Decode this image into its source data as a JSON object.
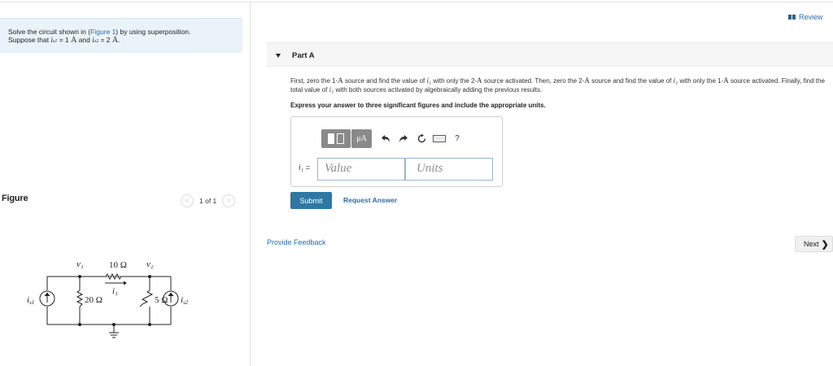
{
  "problem": {
    "line1_pre": "Solve the circuit shown in (",
    "figure_link": "Figure 1",
    "line1_post": ") by using superposition.",
    "line2_pre": "Suppose that ",
    "var_i_s1": "i",
    "sub_s1": "s1",
    "eq1": " = 1 ",
    "unit1": "A",
    "and": " and ",
    "var_i_s2": "i",
    "sub_s2": "s2",
    "eq2": " = 2 ",
    "unit2": "A",
    "end": "."
  },
  "figure": {
    "label": "Figure",
    "pager_text": "1 of 1",
    "prev_glyph": "‹",
    "next_glyph": "›"
  },
  "circuit": {
    "v1": "v₁",
    "v2": "v₂",
    "r_top": "10 Ω",
    "r_left": "20 Ω",
    "r_right": "5 Ω",
    "i1": "i₁",
    "is1": "i",
    "is1_sub": "s1",
    "is2": "i",
    "is2_sub": "s2"
  },
  "review": {
    "label": "Review"
  },
  "part": {
    "title": "Part A",
    "instructions": [
      "First, zero the 1-",
      "A",
      " source and find the value of ",
      "i₁",
      " with only the 2-",
      "A",
      " source activated. Then, zero the 2-",
      "A",
      " source and find the value of ",
      "i₁",
      " with only the 1-",
      "A",
      " source activated. Finally, find the total value of ",
      "i₁",
      " with both sources activated by algebraically adding the previous results."
    ],
    "express": "Express your answer to three significant figures and include the appropriate units."
  },
  "toolbar": {
    "units_label": "μA",
    "help": "?"
  },
  "answer": {
    "var_label": "i₁",
    "equals": " =",
    "value_placeholder": "Value",
    "units_placeholder": "Units"
  },
  "actions": {
    "submit": "Submit",
    "request_answer": "Request Answer",
    "provide_feedback": "Provide Feedback",
    "next": "Next",
    "next_glyph": "❯"
  },
  "colors": {
    "link": "#2a6ea8",
    "submit_bg": "#2f77a4",
    "problem_bg": "#eaf3f9",
    "toolbar_gray": "#8a8a8a"
  }
}
